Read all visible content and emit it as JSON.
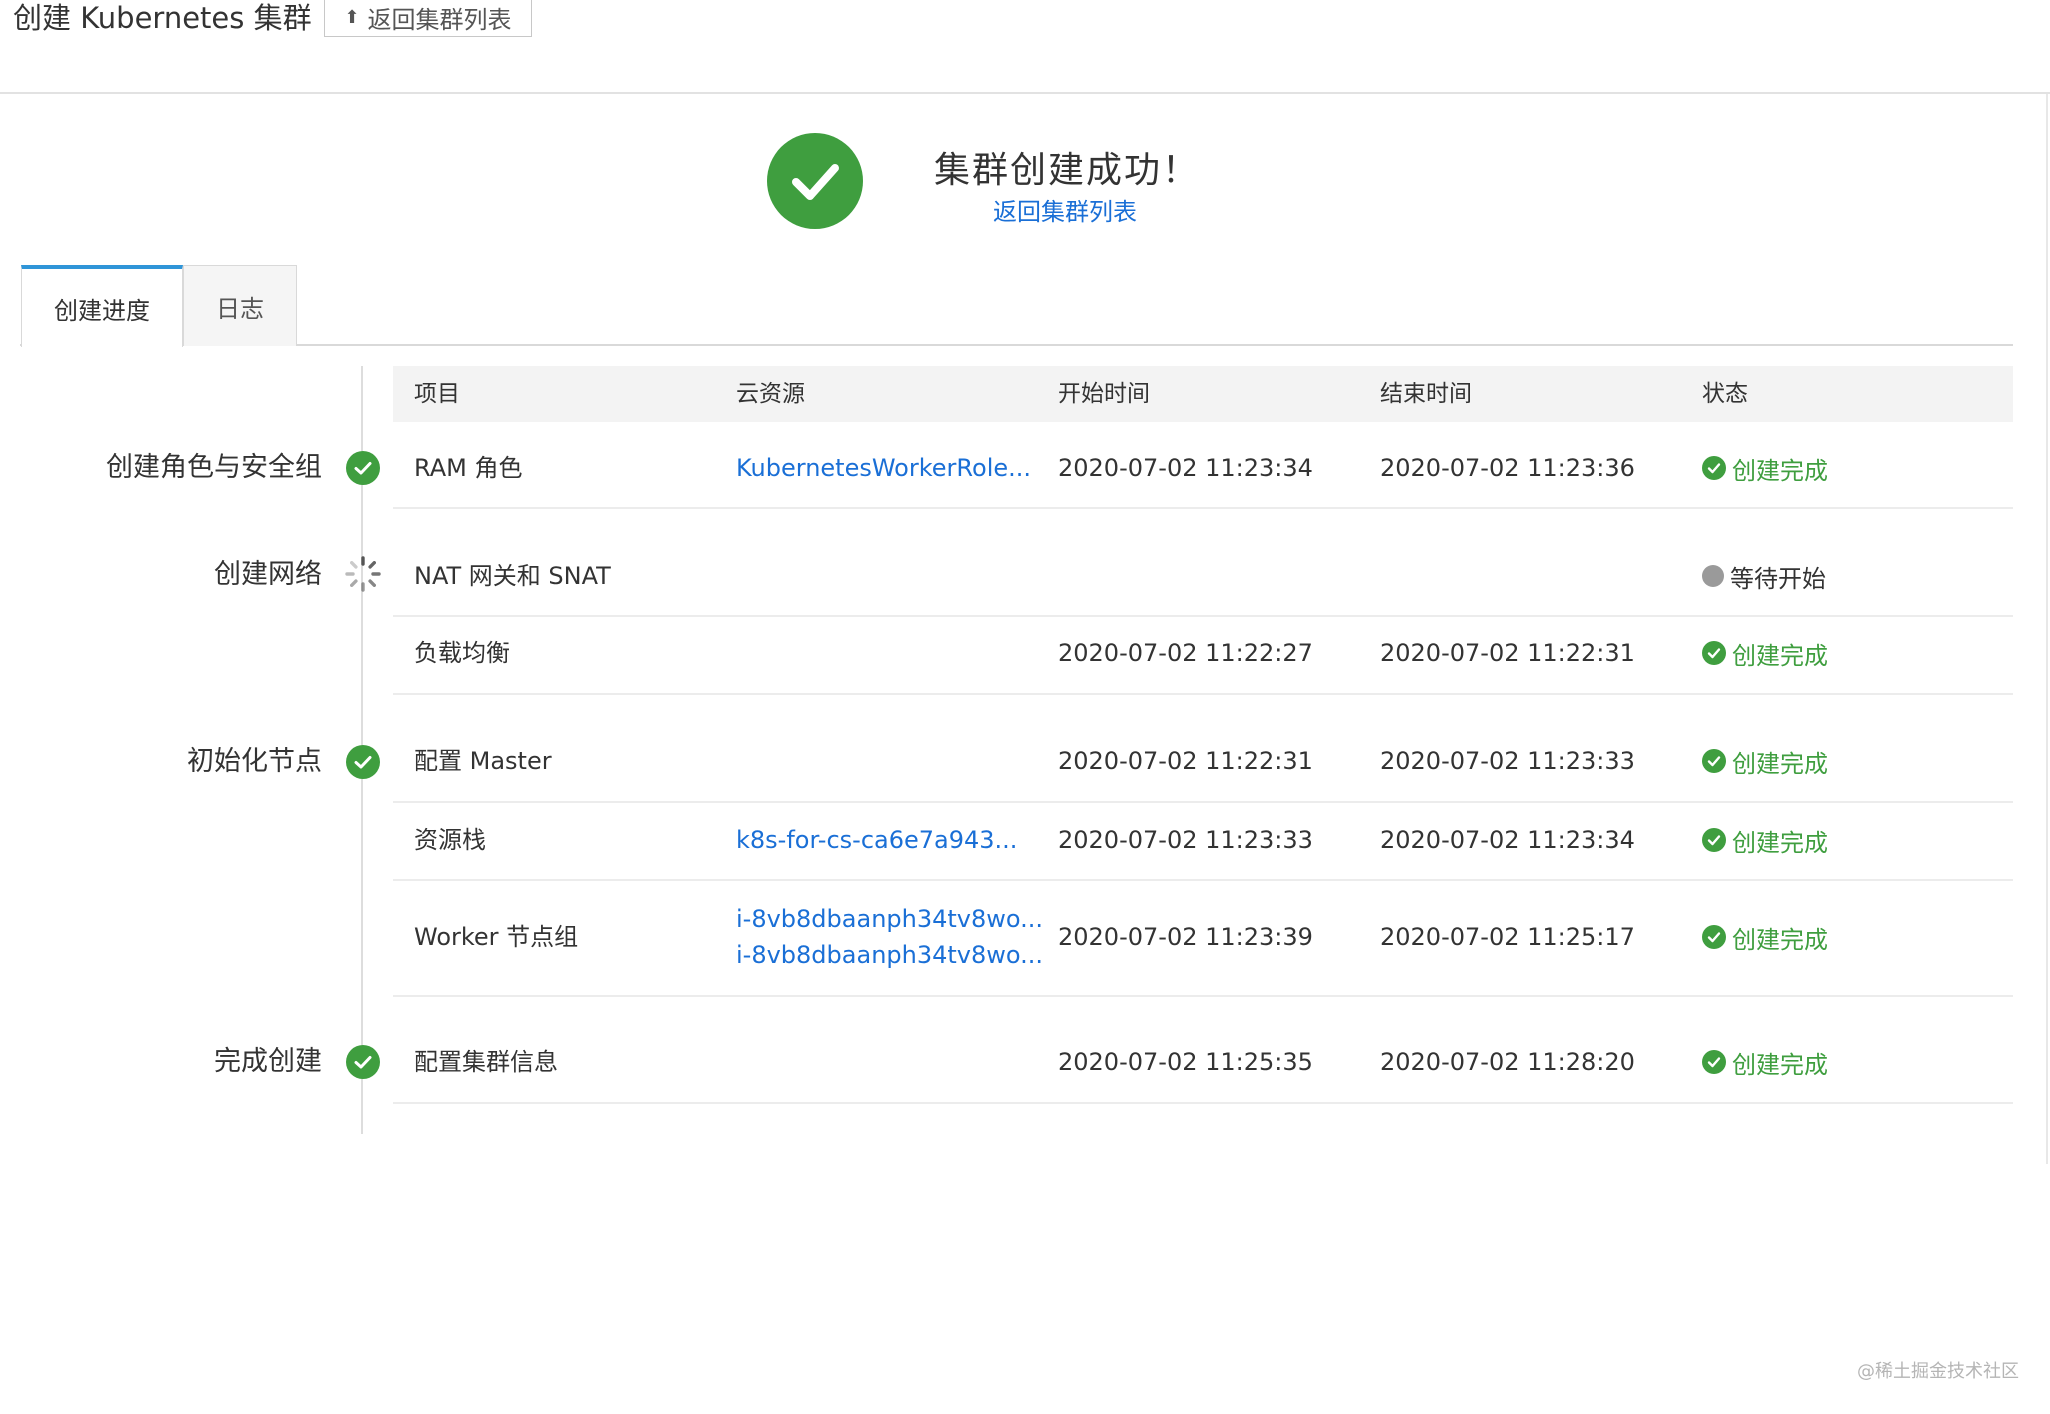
{
  "header": {
    "title": "创建 Kubernetes 集群",
    "back_button": "返回集群列表"
  },
  "banner": {
    "title": "集群创建成功！",
    "link": "返回集群列表"
  },
  "tabs": [
    {
      "label": "创建进度",
      "active": true
    },
    {
      "label": "日志",
      "active": false
    }
  ],
  "stages": [
    {
      "label": "创建角色与安全组",
      "state": "done"
    },
    {
      "label": "创建网络",
      "state": "loading"
    },
    {
      "label": "初始化节点",
      "state": "done"
    },
    {
      "label": "完成创建",
      "state": "done"
    }
  ],
  "table": {
    "columns": [
      "项目",
      "云资源",
      "开始时间",
      "结束时间",
      "状态"
    ],
    "rows": [
      {
        "item": "RAM 角色",
        "resource": "KubernetesWorkerRole...",
        "resource2": "",
        "start": "2020-07-02 11:23:34",
        "end": "2020-07-02 11:23:36",
        "status": "创建完成",
        "state": "done"
      },
      {
        "item": "NAT 网关和 SNAT",
        "resource": "",
        "resource2": "",
        "start": "",
        "end": "",
        "status": "等待开始",
        "state": "wait"
      },
      {
        "item": "负载均衡",
        "resource": "",
        "resource2": "",
        "start": "2020-07-02 11:22:27",
        "end": "2020-07-02 11:22:31",
        "status": "创建完成",
        "state": "done"
      },
      {
        "item": "配置 Master",
        "resource": "",
        "resource2": "",
        "start": "2020-07-02 11:22:31",
        "end": "2020-07-02 11:23:33",
        "status": "创建完成",
        "state": "done"
      },
      {
        "item": "资源栈",
        "resource": "k8s-for-cs-ca6e7a943...",
        "resource2": "",
        "start": "2020-07-02 11:23:33",
        "end": "2020-07-02 11:23:34",
        "status": "创建完成",
        "state": "done"
      },
      {
        "item": "Worker 节点组",
        "resource": "i-8vb8dbaanph34tv8wo...",
        "resource2": "i-8vb8dbaanph34tv8wo...",
        "start": "2020-07-02 11:23:39",
        "end": "2020-07-02 11:25:17",
        "status": "创建完成",
        "state": "done"
      },
      {
        "item": "配置集群信息",
        "resource": "",
        "resource2": "",
        "start": "2020-07-02 11:25:35",
        "end": "2020-07-02 11:28:20",
        "status": "创建完成",
        "state": "done"
      }
    ]
  },
  "watermark": "@稀土掘金技术社区",
  "colors": {
    "success": "#3f9e3f",
    "link": "#1a6fd6",
    "tab_accent": "#2f95d8",
    "wait_dot": "#9a9a9a"
  }
}
